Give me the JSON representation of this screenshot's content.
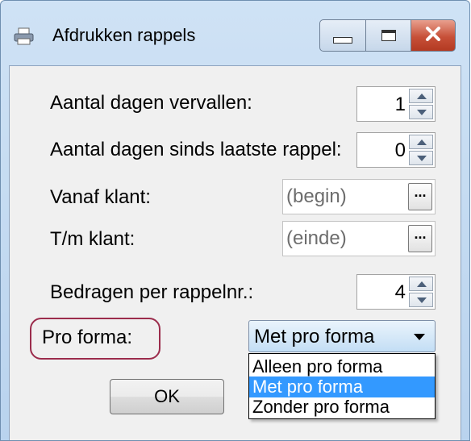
{
  "window": {
    "title": "Afdrukken rappels"
  },
  "fields": {
    "days_overdue": {
      "label": "Aantal dagen vervallen:",
      "value": "1"
    },
    "days_since_last": {
      "label": "Aantal dagen sinds laatste rappel:",
      "value": "0"
    },
    "from_client": {
      "label": "Vanaf klant:",
      "placeholder": "(begin)",
      "button": "..."
    },
    "to_client": {
      "label": "T/m klant:",
      "placeholder": "(einde)",
      "button": "..."
    },
    "amounts_per_reminder": {
      "label": "Bedragen per rappelnr.:",
      "value": "4"
    },
    "pro_forma": {
      "label": "Pro forma:",
      "selected": "Met pro forma",
      "options": [
        "Alleen pro forma",
        "Met pro forma",
        "Zonder pro forma"
      ]
    }
  },
  "buttons": {
    "ok": "OK"
  }
}
